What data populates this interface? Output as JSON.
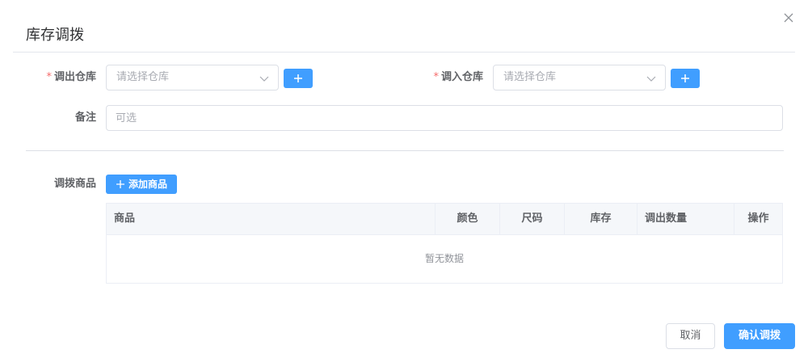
{
  "dialog": {
    "title": "库存调拨",
    "close_icon": "close-icon"
  },
  "form": {
    "from_warehouse": {
      "label": "调出仓库",
      "required": "*",
      "placeholder": "请选择仓库"
    },
    "to_warehouse": {
      "label": "调入仓库",
      "required": "*",
      "placeholder": "请选择仓库"
    },
    "remark": {
      "label": "备注",
      "placeholder": "可选",
      "value": ""
    },
    "goods": {
      "label": "调拨商品",
      "add_button": "添加商品"
    }
  },
  "table": {
    "columns": [
      "商品",
      "颜色",
      "尺码",
      "库存",
      "调出数量",
      "操作"
    ],
    "empty_text": "暂无数据"
  },
  "footer": {
    "cancel": "取消",
    "confirm": "确认调拨"
  },
  "colors": {
    "primary": "#409eff",
    "required": "#f56c6c",
    "border": "#dcdfe6"
  }
}
